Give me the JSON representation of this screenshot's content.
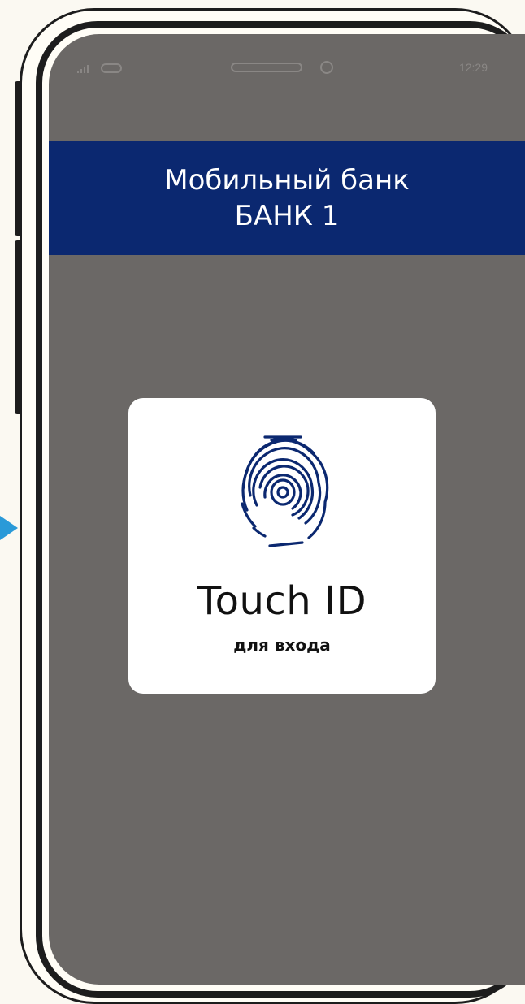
{
  "status_bar": {
    "time": "12:29"
  },
  "header": {
    "line1": "Мобильный банк",
    "line2": "БАНК 1",
    "bg_color": "#0b2870"
  },
  "touch_card": {
    "title": "Touch ID",
    "subtitle": "для входа",
    "icon": "fingerprint-icon",
    "icon_color": "#0b2870"
  },
  "colors": {
    "screen": "#6b6866",
    "arrow": "#2a9ad8"
  }
}
